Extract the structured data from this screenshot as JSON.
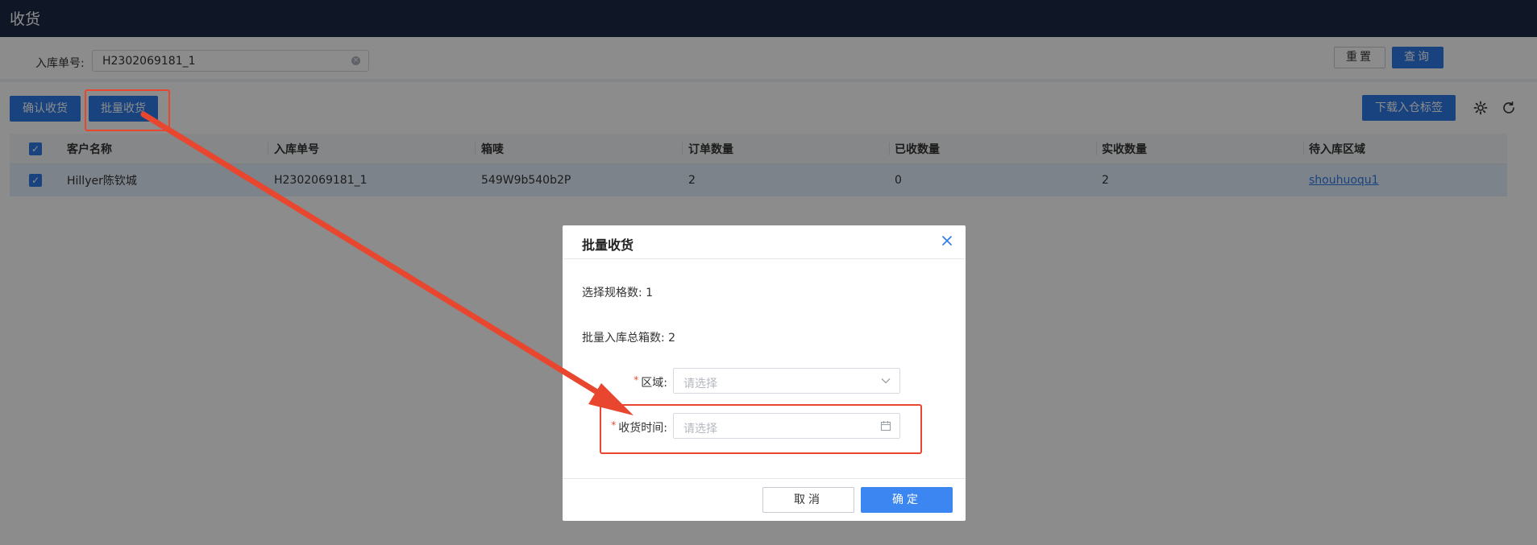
{
  "header": {
    "title": "收货"
  },
  "filter": {
    "label": "入库单号:",
    "value": "H2302069181_1",
    "reset_label": "重置",
    "query_label": "查询"
  },
  "toolbar": {
    "confirm_label": "确认收货",
    "batch_label": "批量收货",
    "download_label": "下载入仓标签",
    "settings_icon": "gear-icon",
    "refresh_icon": "refresh-icon"
  },
  "table": {
    "columns": [
      "客户名称",
      "入库单号",
      "箱唛",
      "订单数量",
      "已收数量",
      "实收数量",
      "待入库区域"
    ],
    "rows": [
      [
        "Hillyer陈钦城",
        "H2302069181_1",
        "549W9b540b2P",
        "2",
        "0",
        "2",
        "shouhuoqu1"
      ]
    ]
  },
  "modal": {
    "title": "批量收货",
    "spec_count": "选择规格数: 1",
    "box_total": "批量入库总箱数: 2",
    "area_label": "区域:",
    "area_placeholder": "请选择",
    "date_label": "收货时间:",
    "date_placeholder": "请选择",
    "cancel_label": "取消",
    "ok_label": "确定",
    "required_mark": "*"
  },
  "colors": {
    "topbar": "#1c2b45",
    "primary": "#2f7ae8",
    "annotation": "#e8462e"
  }
}
